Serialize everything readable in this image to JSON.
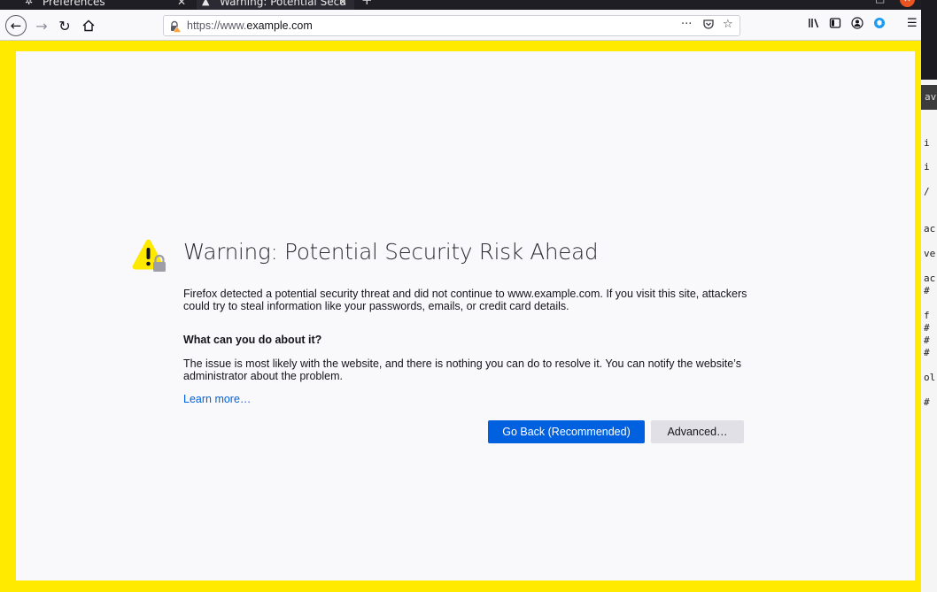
{
  "browser": {
    "tabs": [
      {
        "label": "Preferences",
        "icon": "gear-icon",
        "close": "✕"
      },
      {
        "label": "Warning: Potential Secu",
        "icon": "warning-icon",
        "close": "✕"
      }
    ],
    "new_tab": "+",
    "url": {
      "prefix": "https://www.",
      "domain": "example.com",
      "suffix": ""
    },
    "url_actions": {
      "more": "···",
      "pocket": "pocket-icon",
      "bookmark": "star-icon"
    },
    "toolbar_icons": [
      "library-icon",
      "sidebar-icon",
      "account-icon",
      "extension-icon",
      "menu-icon"
    ]
  },
  "error_page": {
    "title": "Warning: Potential Security Risk Ahead",
    "intro": "Firefox detected a potential security threat and did not continue to www.example.com. If you visit this site, attackers could try to steal information like your passwords, emails, or credit card details.",
    "heading": "What can you do about it?",
    "body": "The issue is most likely with the website, and there is nothing you can do to resolve it. You can notify the website’s administrator about the problem.",
    "learn_more": "Learn more…",
    "go_back": "Go Back (Recommended)",
    "advanced": "Advanced…"
  },
  "background_terminal": {
    "title": "av",
    "lines": [
      "i",
      "i",
      "/",
      "ac",
      "ve",
      "ac",
      "#",
      "f",
      "#",
      "#",
      "#",
      "ol",
      "#"
    ]
  },
  "colors": {
    "accent": "#0061e0",
    "warning_frame": "#ffea00",
    "warning_icon": "#ffe900"
  }
}
